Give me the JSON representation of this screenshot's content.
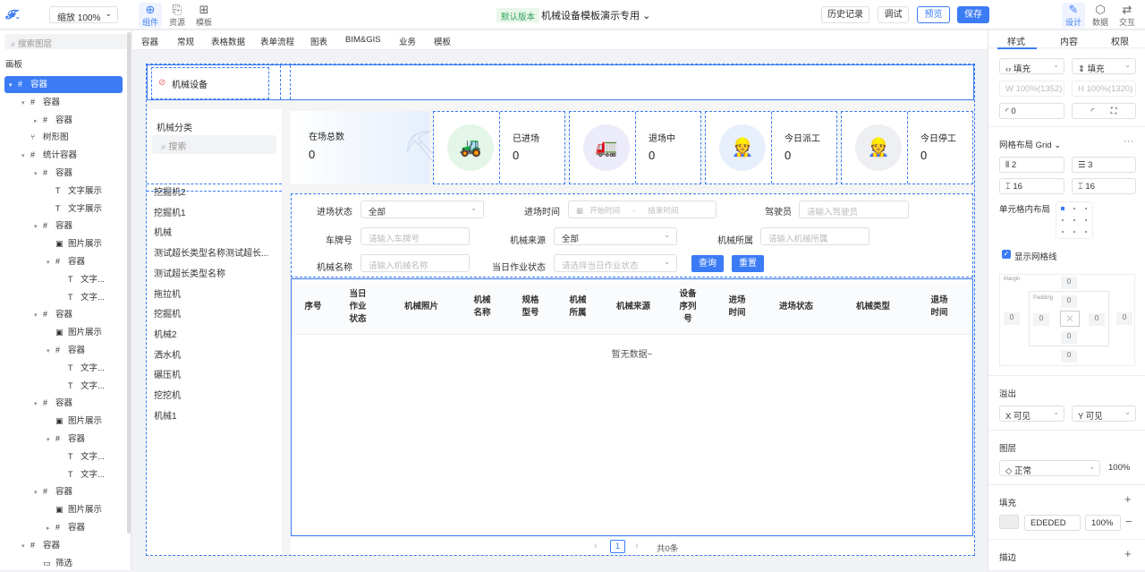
{
  "topbar": {
    "zoom_label": "缩放 100%",
    "icons": [
      {
        "label": "组件",
        "icon": "component-icon",
        "active": true
      },
      {
        "label": "资源",
        "icon": "resource-icon",
        "active": false
      },
      {
        "label": "模板",
        "icon": "template-icon",
        "active": false
      }
    ],
    "version_badge": "默认版本",
    "title": "机械设备模板演示专用",
    "history": "历史记录",
    "debug": "调试",
    "preview": "预览",
    "save": "保存",
    "right_icons": [
      {
        "label": "设计",
        "icon": "design-icon"
      },
      {
        "label": "数据",
        "icon": "data-icon"
      },
      {
        "label": "交互",
        "icon": "interaction-icon"
      }
    ]
  },
  "left": {
    "search_placeholder": "搜索图层",
    "section": "画板",
    "tree": [
      {
        "label": "容器",
        "level": 0,
        "arrow": "▾",
        "icon": "#",
        "selected": true
      },
      {
        "label": "容器",
        "level": 1,
        "arrow": "▾",
        "icon": "#"
      },
      {
        "label": "容器",
        "level": 2,
        "arrow": "▸",
        "icon": "#"
      },
      {
        "label": "树形图",
        "level": 1,
        "arrow": "",
        "icon": "⑂"
      },
      {
        "label": "统计容器",
        "level": 1,
        "arrow": "▾",
        "icon": "#"
      },
      {
        "label": "容器",
        "level": 2,
        "arrow": "▾",
        "icon": "#"
      },
      {
        "label": "文字展示",
        "level": 3,
        "arrow": "",
        "icon": "T"
      },
      {
        "label": "文字展示",
        "level": 3,
        "arrow": "",
        "icon": "T"
      },
      {
        "label": "容器",
        "level": 2,
        "arrow": "▾",
        "icon": "#"
      },
      {
        "label": "图片展示",
        "level": 3,
        "arrow": "",
        "icon": "▣"
      },
      {
        "label": "容器",
        "level": 3,
        "arrow": "▾",
        "icon": "#"
      },
      {
        "label": "文字...",
        "level": 4,
        "arrow": "",
        "icon": "T"
      },
      {
        "label": "文字...",
        "level": 4,
        "arrow": "",
        "icon": "T"
      },
      {
        "label": "容器",
        "level": 2,
        "arrow": "▾",
        "icon": "#"
      },
      {
        "label": "图片展示",
        "level": 3,
        "arrow": "",
        "icon": "▣"
      },
      {
        "label": "容器",
        "level": 3,
        "arrow": "▾",
        "icon": "#"
      },
      {
        "label": "文字...",
        "level": 4,
        "arrow": "",
        "icon": "T"
      },
      {
        "label": "文字...",
        "level": 4,
        "arrow": "",
        "icon": "T"
      },
      {
        "label": "容器",
        "level": 2,
        "arrow": "▾",
        "icon": "#"
      },
      {
        "label": "图片展示",
        "level": 3,
        "arrow": "",
        "icon": "▣"
      },
      {
        "label": "容器",
        "level": 3,
        "arrow": "▾",
        "icon": "#"
      },
      {
        "label": "文字...",
        "level": 4,
        "arrow": "",
        "icon": "T"
      },
      {
        "label": "文字...",
        "level": 4,
        "arrow": "",
        "icon": "T"
      },
      {
        "label": "容器",
        "level": 2,
        "arrow": "▾",
        "icon": "#"
      },
      {
        "label": "图片展示",
        "level": 3,
        "arrow": "",
        "icon": "▣"
      },
      {
        "label": "容器",
        "level": 3,
        "arrow": "▸",
        "icon": "#"
      },
      {
        "label": "容器",
        "level": 1,
        "arrow": "▾",
        "icon": "#"
      },
      {
        "label": "筛选",
        "level": 2,
        "arrow": "",
        "icon": "▭"
      }
    ]
  },
  "tabs": [
    "容器",
    "常规",
    "表格数据",
    "表单流程",
    "图表",
    "BIM&GIS",
    "业务",
    "模板"
  ],
  "canvas": {
    "header_title": "机械设备",
    "category_title": "机械分类",
    "category_search": "搜索",
    "categories": [
      "挖掘机2",
      "挖掘机1",
      "机械",
      "测试超长类型名称测试超长...",
      "测试超长类型名称",
      "拖拉机",
      "挖掘机",
      "机械2",
      "洒水机",
      "碾压机",
      "挖挖机",
      "机械1"
    ],
    "stats": [
      {
        "label": "在场总数",
        "value": "0"
      },
      {
        "label": "已进场",
        "value": "0"
      },
      {
        "label": "退场中",
        "value": "0"
      },
      {
        "label": "今日派工",
        "value": "0"
      },
      {
        "label": "今日停工",
        "value": "0"
      }
    ],
    "filters": {
      "entry_status_label": "进场状态",
      "entry_status_value": "全部",
      "entry_time_label": "进场时间",
      "start_placeholder": "开始时间",
      "range_sep": "-",
      "end_placeholder": "结束时间",
      "driver_label": "驾驶员",
      "driver_placeholder": "请输入驾驶员",
      "plate_label": "车牌号",
      "plate_placeholder": "请输入车牌号",
      "source_label": "机械来源",
      "source_value": "全部",
      "owner_label": "机械所属",
      "owner_placeholder": "请输入机械所属",
      "name_label": "机械名称",
      "name_placeholder": "请输入机械名称",
      "work_status_label": "当日作业状态",
      "work_status_placeholder": "请选择当日作业状态",
      "query": "查询",
      "reset": "重置"
    },
    "columns": [
      "序号",
      "当日作业状态",
      "机械照片",
      "机械名称",
      "规格型号",
      "机械所属",
      "机械来源",
      "设备序列号",
      "进场时间",
      "进场状态",
      "机械类型",
      "退场时间"
    ],
    "empty": "暂无数据~",
    "pager": {
      "prev": "‹",
      "page": "1",
      "next": "›",
      "total": "共0条"
    }
  },
  "right": {
    "tabs": [
      "样式",
      "内容",
      "权限"
    ],
    "fill_w": "填充",
    "fill_h": "填充",
    "w_placeholder": "100%(1352)",
    "h_placeholder": "100%(1320)",
    "radius": "0",
    "grid_label": "网格布局 Grid",
    "rows": "2",
    "cols": "3",
    "gap_x": "16",
    "gap_y": "16",
    "cell_layout": "单元格内布局",
    "show_grid": "显示网格线",
    "margin_label": "Margin",
    "padding_label": "Padding",
    "zero": "0",
    "overflow": "溢出",
    "ox": "X  可见",
    "oy": "Y  可见",
    "layer": "图层",
    "blend": "正常",
    "opacity": "100%",
    "fill": "填充",
    "fill_hex": "EDEDED",
    "fill_opacity": "100%",
    "stroke": "描边",
    "colors": {
      "accent": "#3b7cf5",
      "fill_swatch": "#ededed"
    }
  }
}
